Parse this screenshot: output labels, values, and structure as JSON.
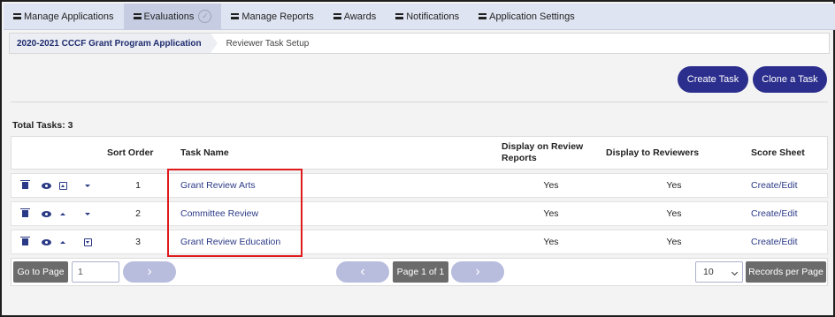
{
  "nav": {
    "items": [
      {
        "label": "Manage Applications"
      },
      {
        "label": "Evaluations"
      },
      {
        "label": "Manage Reports"
      },
      {
        "label": "Awards"
      },
      {
        "label": "Notifications"
      },
      {
        "label": "Application Settings"
      }
    ],
    "active_index": 1,
    "active_icon": "check-circle-icon"
  },
  "breadcrumb": {
    "parent": "2020-2021 CCCF Grant Program Application",
    "current": "Reviewer Task Setup"
  },
  "actions": {
    "create_label": "Create Task",
    "clone_label": "Clone a Task"
  },
  "summary": {
    "total_tasks": "Total Tasks: 3"
  },
  "table": {
    "headers": {
      "sort_order": "Sort Order",
      "task_name": "Task Name",
      "display_on_review_reports": "Display on Review Reports",
      "display_to_reviewers": "Display to Reviewers",
      "score_sheet": "Score Sheet"
    },
    "rows": [
      {
        "sort_order": "1",
        "task_name": "Grant Review Arts",
        "display_on_review_reports": "Yes",
        "display_to_reviewers": "Yes",
        "score_sheet": "Create/Edit",
        "icons": [
          "trash-icon",
          "eye-icon",
          "move-to-top-icon",
          "move-down-icon"
        ]
      },
      {
        "sort_order": "2",
        "task_name": "Committee Review",
        "display_on_review_reports": "Yes",
        "display_to_reviewers": "Yes",
        "score_sheet": "Create/Edit",
        "icons": [
          "trash-icon",
          "eye-icon",
          "move-up-icon",
          "move-down-icon"
        ]
      },
      {
        "sort_order": "3",
        "task_name": "Grant Review Education",
        "display_on_review_reports": "Yes",
        "display_to_reviewers": "Yes",
        "score_sheet": "Create/Edit",
        "icons": [
          "trash-icon",
          "eye-icon",
          "move-up-icon",
          "move-to-bottom-icon"
        ]
      }
    ]
  },
  "pagination": {
    "go_to_page_label": "Go to Page",
    "page_input_value": "1",
    "page_info": "Page 1 of 1",
    "records_per_page_value": "10",
    "records_per_page_label": "Records per Page"
  },
  "colors": {
    "accent": "#2b2e8c",
    "link": "#2b3a86",
    "highlight": "#e01a1a",
    "nav_background": "#dfe4f2"
  }
}
